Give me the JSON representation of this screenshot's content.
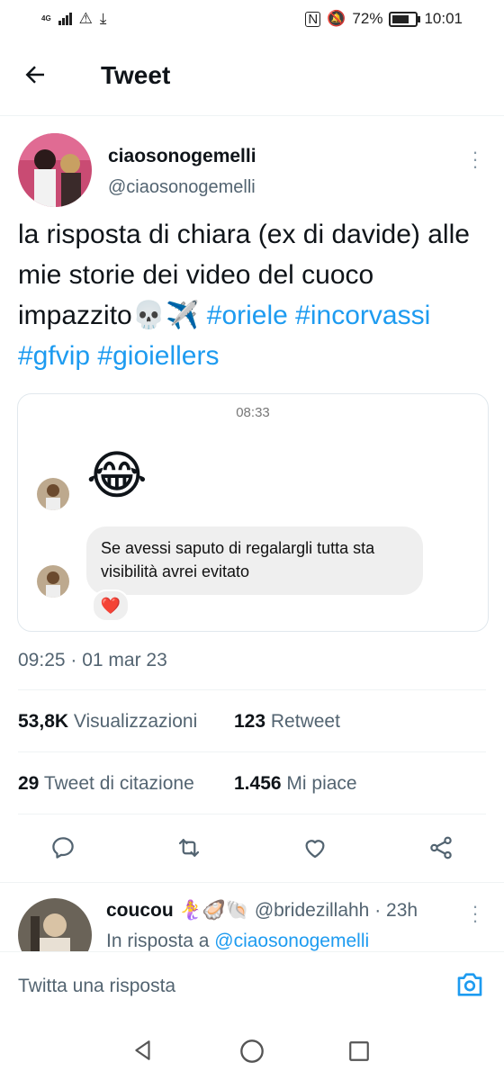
{
  "status_bar": {
    "network": "4G",
    "battery": "72%",
    "time": "10:01"
  },
  "header": {
    "title": "Tweet"
  },
  "tweet": {
    "display_name": "ciaosonogemelli",
    "handle": "@ciaosonogemelli",
    "text_plain": "la risposta di chiara (ex di davide) alle mie storie dei video del cuoco impazzito💀✈️",
    "hashtags": [
      "#oriele",
      "#incorvassi",
      "#gfvip",
      "#gioiellers"
    ],
    "media": {
      "time": "08:33",
      "emoji": "😂",
      "message": "Se avessi saputo di regalargli tutta sta visibilità avrei evitato",
      "reaction": "❤️"
    },
    "timestamp": "09:25 · 01 mar 23",
    "stats": {
      "views_count": "53,8K",
      "views_label": "Visualizzazioni",
      "retweets_count": "123",
      "retweets_label": "Retweet",
      "quotes_count": "29",
      "quotes_label": "Tweet di citazione",
      "likes_count": "1.456",
      "likes_label": "Mi piace"
    }
  },
  "reply": {
    "display_name": "coucou",
    "emojis": "🧜‍♀️🦪🐚",
    "handle": "@bridezillahh",
    "time": "· 23h",
    "in_reply_prefix": "In risposta a",
    "in_reply_handle": "@ciaosonogemelli"
  },
  "composer": {
    "placeholder": "Twitta una risposta"
  },
  "colors": {
    "accent": "#1d9bf0",
    "muted": "#536471"
  }
}
